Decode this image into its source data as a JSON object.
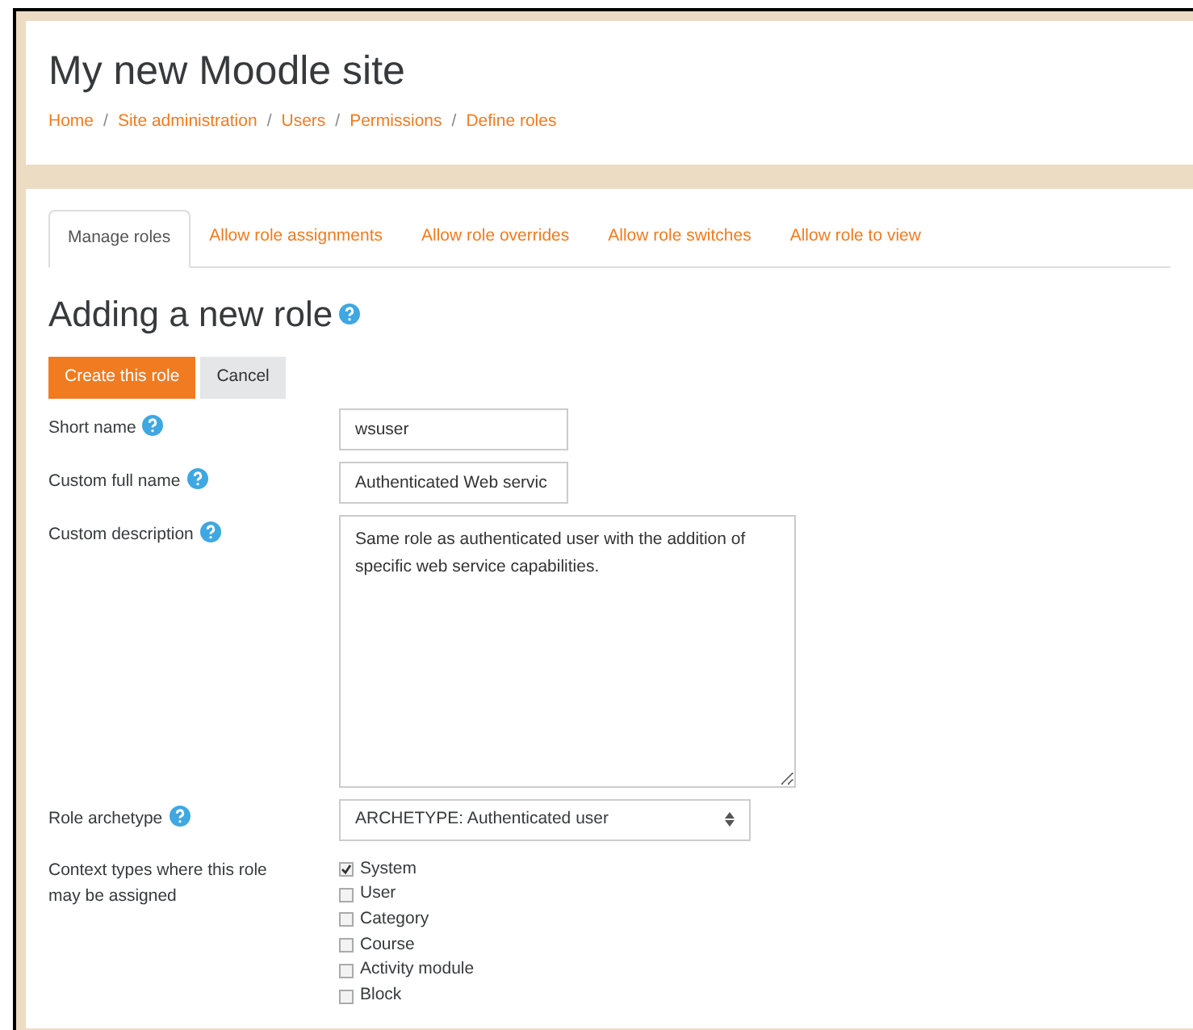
{
  "header": {
    "site_title": "My new Moodle site",
    "breadcrumbs": [
      {
        "label": "Home"
      },
      {
        "separator": "/",
        "label": "Site administration"
      },
      {
        "separator": "/",
        "label": "Users"
      },
      {
        "separator": "/",
        "label": "Permissions"
      },
      {
        "separator": "/",
        "label": "Define roles"
      }
    ]
  },
  "tabs": [
    {
      "label": "Manage roles",
      "selected": true
    },
    {
      "label": "Allow role assignments",
      "selected": false
    },
    {
      "label": "Allow role overrides",
      "selected": false
    },
    {
      "label": "Allow role switches",
      "selected": false
    },
    {
      "label": "Allow role to view",
      "selected": false
    }
  ],
  "heading": "Adding a new role",
  "buttons": [
    {
      "label": "Create this role",
      "kind": "primary"
    },
    {
      "label": "Cancel",
      "kind": "secondary"
    }
  ],
  "fields": [
    {
      "label": "Short name",
      "kind": "text",
      "value": "wsuser",
      "help": true
    },
    {
      "label": "Custom full name",
      "kind": "text",
      "value": "Authenticated Web servic",
      "help": true
    },
    {
      "label": "Custom description",
      "kind": "textarea",
      "value": "Same role as authenticated user with the addition of specific web service capabilities.",
      "help": true
    },
    {
      "label": "Role archetype",
      "kind": "select",
      "value": "ARCHETYPE: Authenticated user",
      "help": true
    }
  ],
  "context_types": {
    "label": "Context types where this role may be assigned",
    "options": [
      {
        "label": "System",
        "checked": true
      },
      {
        "label": "User",
        "checked": false
      },
      {
        "label": "Category",
        "checked": false
      },
      {
        "label": "Course",
        "checked": false
      },
      {
        "label": "Activity module",
        "checked": false
      },
      {
        "label": "Block",
        "checked": false
      }
    ]
  }
}
